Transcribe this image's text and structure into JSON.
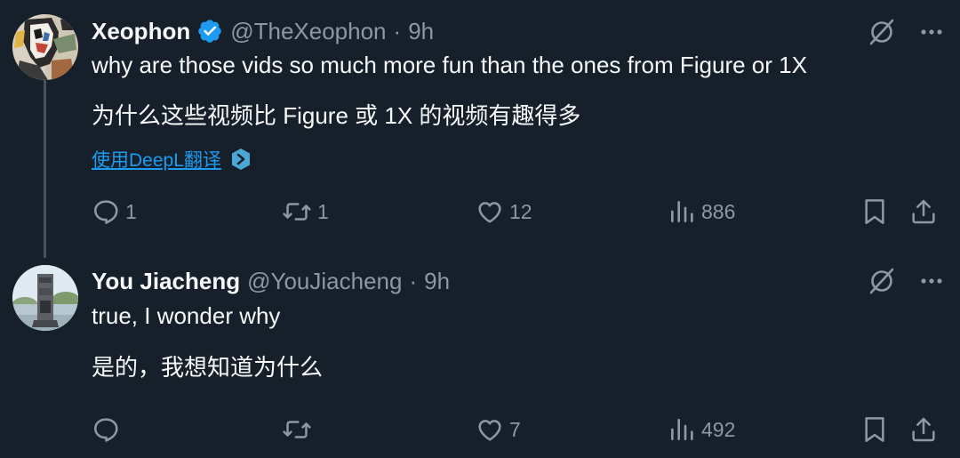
{
  "tweets": [
    {
      "display_name": "Xeophon",
      "handle": "@TheXeophon",
      "separator": "·",
      "time": "9h",
      "verified": true,
      "lines": [
        "why are those vids so much more fun than the ones from Figure or 1X",
        "为什么这些视频比 Figure 或 1X 的视频有趣得多"
      ],
      "translate_label": "使用DeepL翻译",
      "actions": {
        "reply_count": "1",
        "retweet_count": "1",
        "like_count": "12",
        "view_count": "886"
      }
    },
    {
      "display_name": "You Jiacheng",
      "handle": "@YouJiacheng",
      "separator": "·",
      "time": "9h",
      "verified": false,
      "lines": [
        "true, I wonder why",
        "是的，我想知道为什么"
      ],
      "actions": {
        "reply_count": "",
        "retweet_count": "",
        "like_count": "7",
        "view_count": "492"
      }
    }
  ],
  "colors": {
    "background": "#15202b",
    "text_primary": "#f7f9f9",
    "text_secondary": "#8b98a5",
    "link": "#1d9bf0",
    "verified": "#1d9bf0",
    "thread_line": "#425364"
  },
  "icons": {
    "top_actions": [
      "grok-slash-icon",
      "more-icon"
    ],
    "actions": [
      "reply-icon",
      "retweet-icon",
      "like-icon",
      "views-icon",
      "bookmark-icon",
      "share-icon"
    ],
    "translate": "deepl-icon"
  }
}
